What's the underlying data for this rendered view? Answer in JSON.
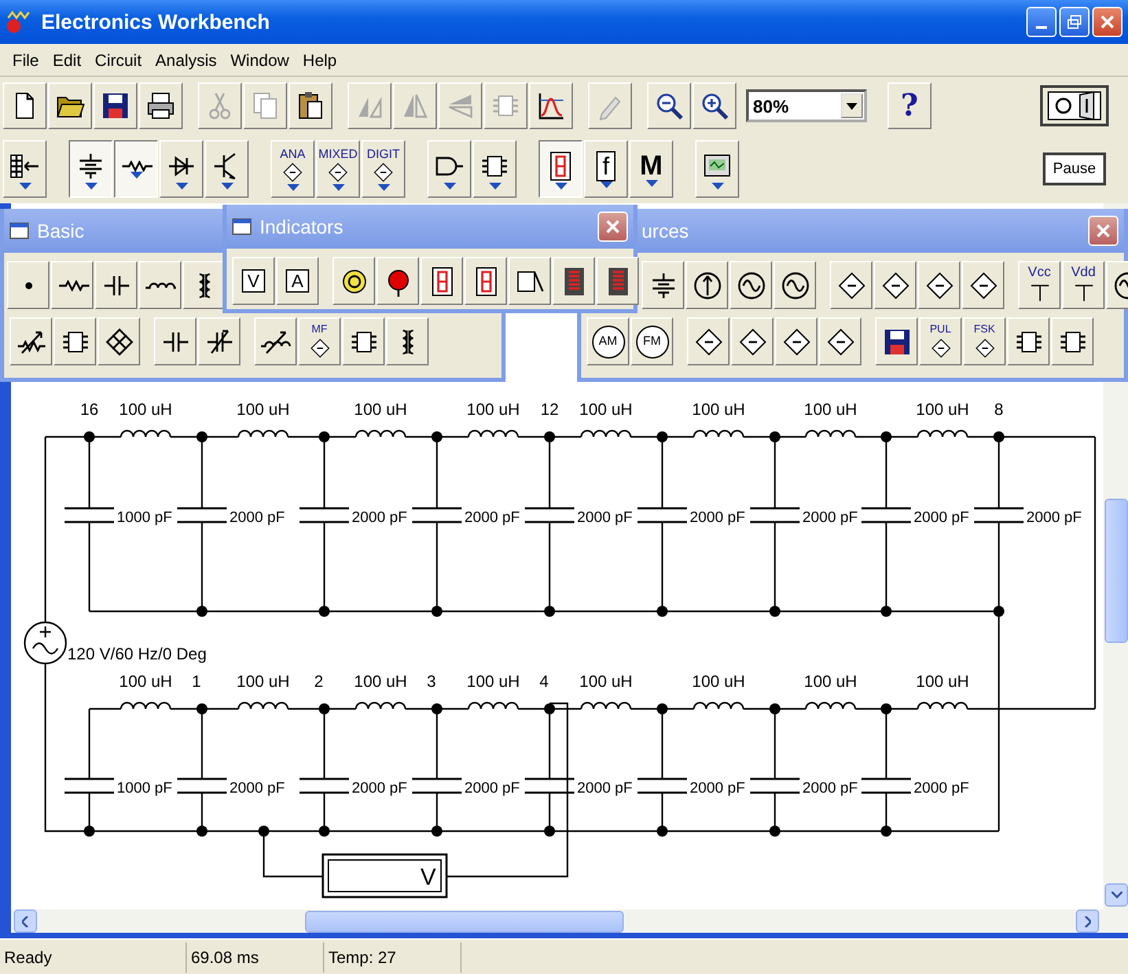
{
  "window": {
    "title": "Electronics Workbench"
  },
  "menu": [
    "File",
    "Edit",
    "Circuit",
    "Analysis",
    "Window",
    "Help"
  ],
  "toolbar": [
    {
      "kind": "new",
      "disabled": false
    },
    {
      "kind": "open",
      "disabled": false
    },
    {
      "kind": "save",
      "disabled": false
    },
    {
      "kind": "print",
      "disabled": false
    },
    {
      "kind": "separator"
    },
    {
      "kind": "cut",
      "disabled": true
    },
    {
      "kind": "copy",
      "disabled": true
    },
    {
      "kind": "paste",
      "disabled": false
    },
    {
      "kind": "separator"
    },
    {
      "kind": "rotate",
      "disabled": true
    },
    {
      "kind": "flip_horizontal",
      "disabled": true
    },
    {
      "kind": "flip_vertical",
      "disabled": true
    },
    {
      "kind": "subcircuit",
      "disabled": true
    },
    {
      "kind": "graphs",
      "disabled": false
    },
    {
      "kind": "separator"
    },
    {
      "kind": "description",
      "disabled": true
    },
    {
      "kind": "separator"
    },
    {
      "kind": "zoom_out",
      "disabled": false
    },
    {
      "kind": "zoom_in",
      "disabled": false
    }
  ],
  "zoom": {
    "value": "80%"
  },
  "help_button": {
    "label": "?"
  },
  "pause_button": {
    "label": "Pause"
  },
  "power_switch": {
    "on": false
  },
  "parts_bins": [
    {
      "kind": "favorites",
      "open": false
    },
    {
      "kind": "separator"
    },
    {
      "kind": "sources",
      "open": true
    },
    {
      "kind": "basic",
      "open": true
    },
    {
      "kind": "diodes",
      "open": false
    },
    {
      "kind": "transistors",
      "open": false
    },
    {
      "kind": "separator"
    },
    {
      "kind": "analog_ics",
      "label": "ANA",
      "open": false
    },
    {
      "kind": "mixed_ics",
      "label": "MIXED",
      "open": false
    },
    {
      "kind": "digital_ics",
      "label": "DIGIT",
      "open": false
    },
    {
      "kind": "separator"
    },
    {
      "kind": "logic_gates",
      "open": false
    },
    {
      "kind": "digital",
      "open": false
    },
    {
      "kind": "separator"
    },
    {
      "kind": "indicators",
      "open": true
    },
    {
      "kind": "controls",
      "label": "f",
      "open": false
    },
    {
      "kind": "miscellaneous",
      "label": "M",
      "open": false
    },
    {
      "kind": "separator"
    },
    {
      "kind": "instruments",
      "open": false
    }
  ],
  "palettes": [
    {
      "title": "Basic",
      "rows": [
        [
          {
            "kind": "junction"
          },
          {
            "kind": "resistor"
          },
          {
            "kind": "capacitor"
          },
          {
            "kind": "inductor"
          },
          {
            "kind": "transformer"
          }
        ],
        [
          {
            "kind": "potentiometer"
          },
          {
            "kind": "resistor_pack"
          },
          {
            "kind": "bridge"
          },
          {
            "kind": "separator"
          },
          {
            "kind": "polarized_capacitor"
          },
          {
            "kind": "variable_capacitor"
          },
          {
            "kind": "separator"
          },
          {
            "kind": "variable_inductor"
          },
          {
            "kind": "magnetic_core",
            "label": "MF"
          },
          {
            "kind": "relay"
          },
          {
            "kind": "coil"
          }
        ]
      ]
    },
    {
      "title": "Indicators",
      "rows": [
        [
          {
            "kind": "voltmeter",
            "label": "V"
          },
          {
            "kind": "ammeter",
            "label": "A"
          },
          {
            "kind": "separator"
          },
          {
            "kind": "bulb"
          },
          {
            "kind": "probe"
          },
          {
            "kind": "seven_segment"
          },
          {
            "kind": "decoded_seven_segment"
          },
          {
            "kind": "buzzer"
          },
          {
            "kind": "bargraph"
          },
          {
            "kind": "bargraph"
          }
        ]
      ]
    },
    {
      "title": "urces",
      "rows": [
        [
          {
            "kind": "battery"
          },
          {
            "kind": "current_source"
          },
          {
            "kind": "ac_source"
          },
          {
            "kind": "clock_source"
          },
          {
            "kind": "separator"
          },
          {
            "kind": "controlled_source"
          },
          {
            "kind": "controlled_source"
          },
          {
            "kind": "controlled_source"
          },
          {
            "kind": "controlled_source"
          },
          {
            "kind": "separator"
          },
          {
            "kind": "rail",
            "label": "Vcc"
          },
          {
            "kind": "rail",
            "label": "Vdd"
          },
          {
            "kind": "circle_source"
          }
        ],
        [
          {
            "kind": "round_source",
            "label": "AM"
          },
          {
            "kind": "round_source",
            "label": "FM"
          },
          {
            "kind": "separator"
          },
          {
            "kind": "diamond_source"
          },
          {
            "kind": "diamond_source"
          },
          {
            "kind": "diamond_source"
          },
          {
            "kind": "diamond_source"
          },
          {
            "kind": "separator"
          },
          {
            "kind": "disk"
          },
          {
            "kind": "diamond_labeled",
            "label": "PUL"
          },
          {
            "kind": "diamond_labeled",
            "label": "FSK"
          },
          {
            "kind": "polynomial"
          },
          {
            "kind": "nonlinear"
          }
        ]
      ]
    }
  ],
  "schematic": {
    "source": {
      "label": "120 V/60 Hz/0 Deg"
    },
    "voltmeter": {
      "label": "V"
    },
    "top_row": {
      "inductors": [
        "100 uH",
        "100 uH",
        "100 uH",
        "100 uH",
        "100 uH",
        "100 uH",
        "100 uH",
        "100 uH"
      ],
      "nodes": [
        {
          "label": "16",
          "capacitor": "1000 pF"
        },
        {
          "capacitor": "2000 pF"
        },
        {
          "capacitor": "2000 pF"
        },
        {
          "capacitor": "2000 pF"
        },
        {
          "label": "12",
          "capacitor": "2000 pF"
        },
        {
          "capacitor": "2000 pF"
        },
        {
          "capacitor": "2000 pF"
        },
        {
          "capacitor": "2000 pF"
        },
        {
          "label": "8",
          "capacitor": "2000 pF"
        }
      ]
    },
    "bottom_row": {
      "inductors": [
        "100 uH",
        "100 uH",
        "100 uH",
        "100 uH",
        "100 uH",
        "100 uH",
        "100 uH",
        "100 uH"
      ],
      "nodes": [
        {
          "capacitor": "1000 pF"
        },
        {
          "label": "1",
          "capacitor": "2000 pF"
        },
        {
          "label": "2",
          "capacitor": "2000 pF"
        },
        {
          "label": "3",
          "capacitor": "2000 pF"
        },
        {
          "label": "4",
          "capacitor": "2000 pF"
        },
        {
          "capacitor": "2000 pF"
        },
        {
          "capacitor": "2000 pF"
        },
        {
          "capacitor": "2000 pF"
        }
      ]
    }
  },
  "status_bar": [
    "Ready",
    "69.08 ms",
    "Temp:  27"
  ]
}
